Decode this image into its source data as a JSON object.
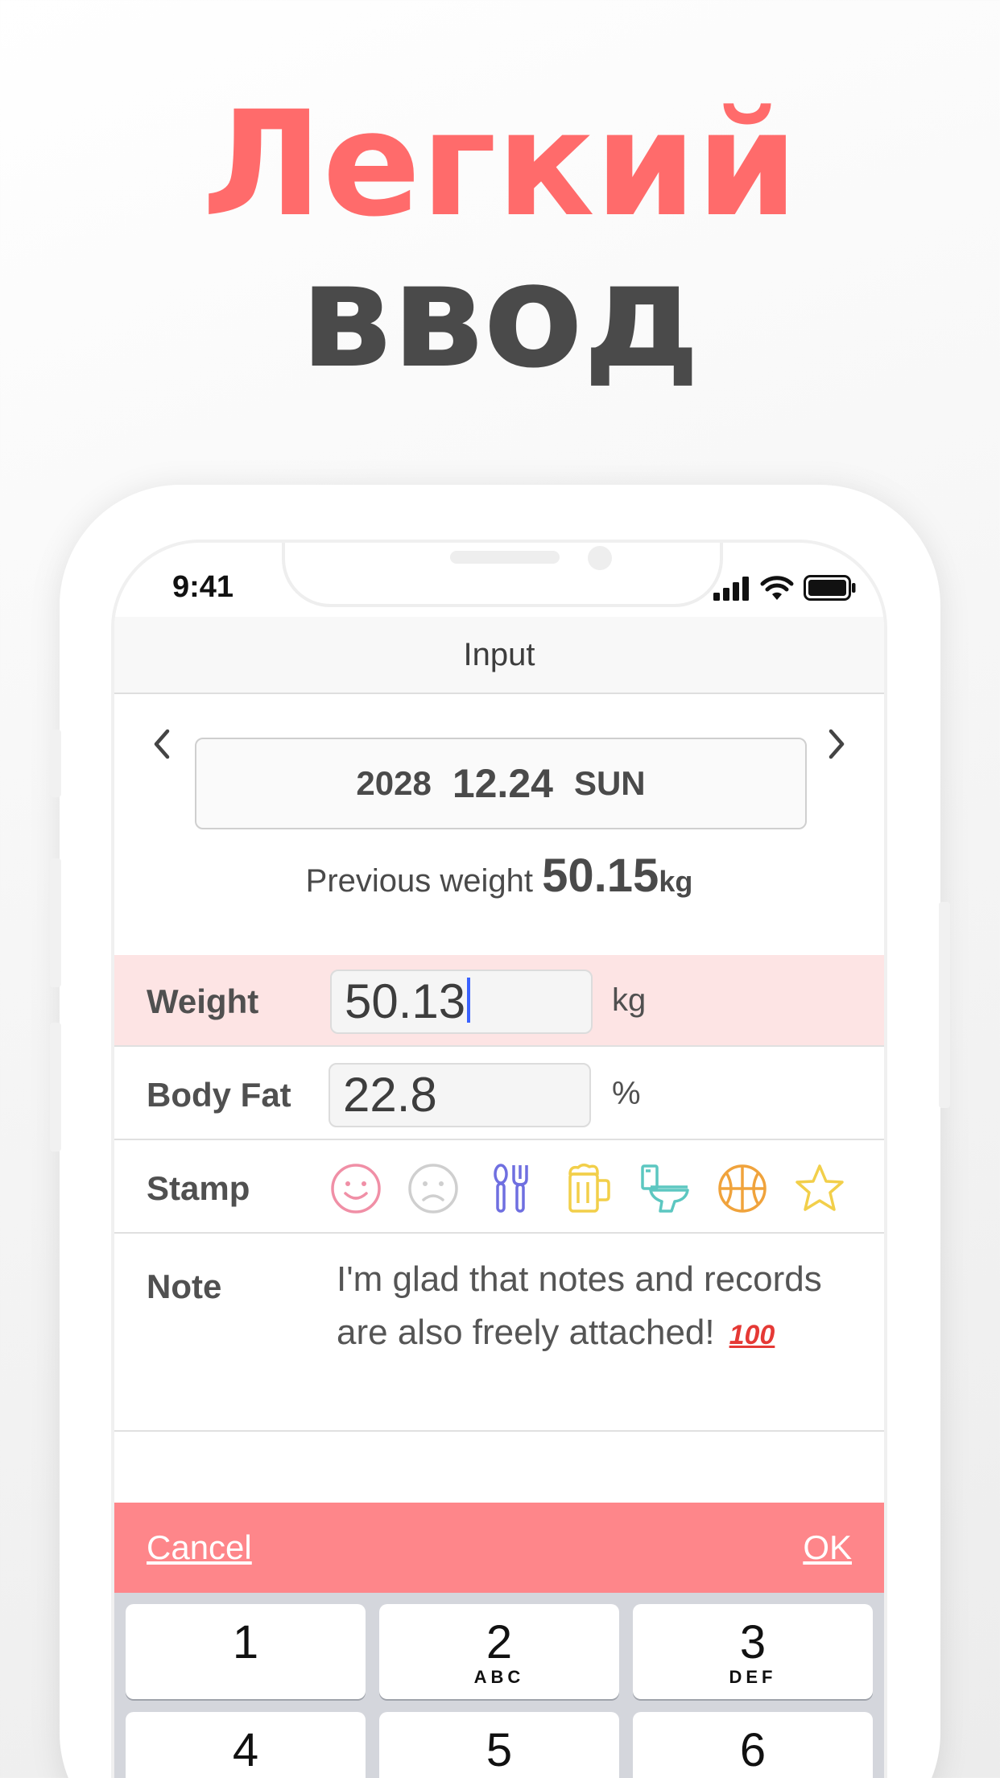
{
  "promo": {
    "line1": "Легкий",
    "line2": "ввод"
  },
  "status_bar": {
    "time": "9:41"
  },
  "nav": {
    "title": "Input"
  },
  "date": {
    "year": "2028",
    "month_day": "12.24",
    "weekday": "SUN"
  },
  "previous_weight": {
    "label": "Previous weight",
    "value": "50.15",
    "unit": "kg"
  },
  "form": {
    "weight": {
      "label": "Weight",
      "value": "50.13",
      "unit": "kg"
    },
    "body_fat": {
      "label": "Body Fat",
      "value": "22.8",
      "unit": "%"
    },
    "stamp": {
      "label": "Stamp",
      "icons": [
        "smile-icon",
        "frown-icon",
        "fork-spoon-icon",
        "beer-icon",
        "toilet-icon",
        "basketball-icon",
        "star-icon"
      ],
      "colors": {
        "smile": "#f08fa6",
        "frown": "#cfcfcf",
        "fork": "#6f6fe0",
        "beer": "#f2cf4a",
        "toilet": "#5cc7c1",
        "ball": "#f0a33c",
        "star": "#f2cf4a"
      }
    },
    "note": {
      "label": "Note",
      "text": "I'm glad that notes and records are also freely attached!",
      "emoji": "100"
    }
  },
  "toolbar": {
    "cancel": "Cancel",
    "ok": "OK"
  },
  "keypad": {
    "keys": [
      {
        "num": "1",
        "letters": ""
      },
      {
        "num": "2",
        "letters": "ABC"
      },
      {
        "num": "3",
        "letters": "DEF"
      },
      {
        "num": "4",
        "letters": ""
      },
      {
        "num": "5",
        "letters": ""
      },
      {
        "num": "6",
        "letters": ""
      }
    ]
  },
  "colors": {
    "accent": "#ff6b6b",
    "toolbar": "#fe868a",
    "weight_row_bg": "#fde4e4",
    "text_dark": "#4a4a4a"
  }
}
